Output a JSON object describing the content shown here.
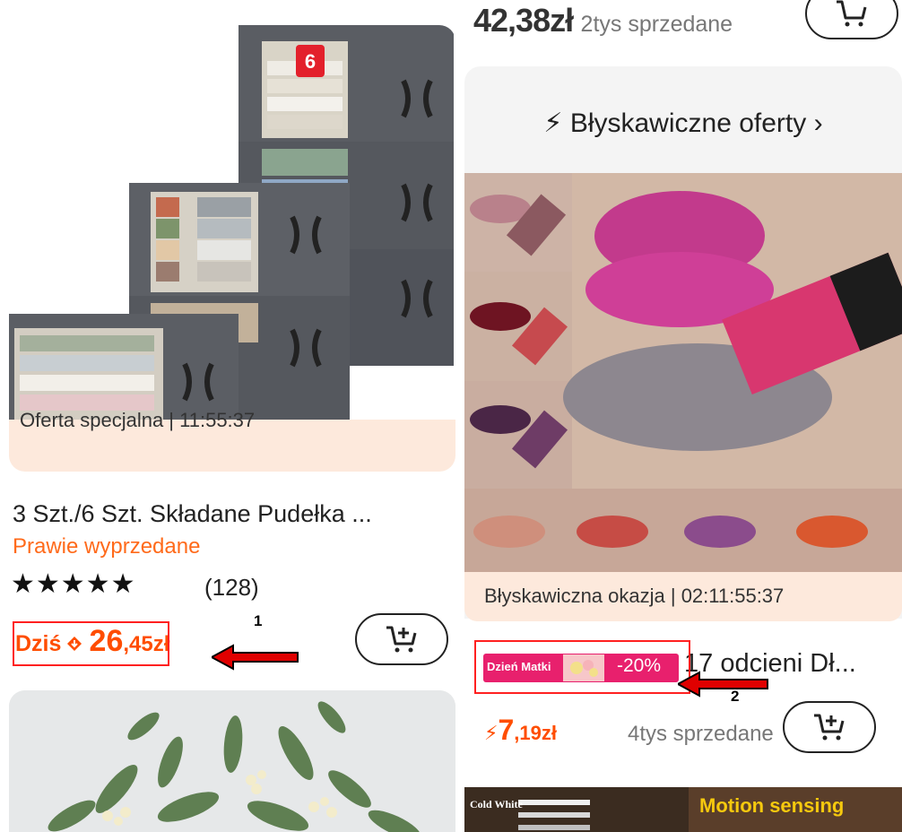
{
  "left_card": {
    "promo_text": "Oferta specjalna | 11:55:37",
    "title": "3 Szt./6 Szt. Składane Pudełka ...",
    "status": "Prawie wyprzedane",
    "stars": "★★★★★",
    "rating": 5,
    "rating_count": "(128)",
    "price_prefix": "Dziś",
    "coin_icon": "🞐",
    "price_int": "26",
    "price_dec": ",45zł",
    "box_count_badge": "6"
  },
  "right_top": {
    "price": "42,38zł",
    "sold": "2tys sprzedane"
  },
  "flash_card": {
    "title": "⚡ Błyskawiczne oferty ›",
    "strip_text": "Błyskawiczna okazja | 02:11:55:37",
    "badge_label": "Dzień Matki",
    "discount": "-20%",
    "title_text": "17 odcieni Dł...",
    "bolt": "⚡",
    "price_int": "7",
    "price_dec": ",19zł",
    "sold": "4tys sprzedane"
  },
  "lamp_card": {
    "left_label": "Cold White",
    "right_label": "Motion sensing"
  },
  "annotations": {
    "one": "1",
    "two": "2"
  },
  "colors": {
    "accent_orange": "#ff4d00",
    "promo_bg": "#fde9dc",
    "badge_pink": "#e8206d",
    "highlight_red": "#ff2020"
  },
  "icons": [
    "cart-plus-icon",
    "lightning-icon",
    "chevron-right-icon",
    "star-icon",
    "coin-icon"
  ]
}
